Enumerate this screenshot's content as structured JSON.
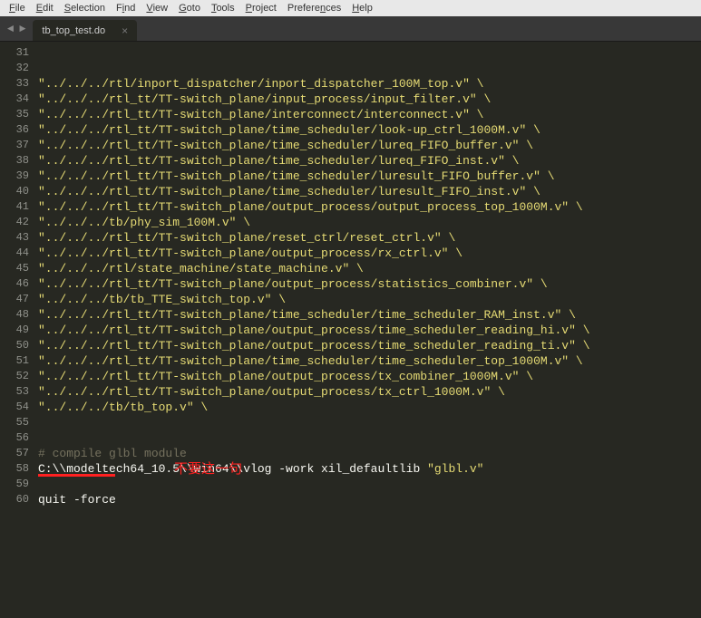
{
  "menubar": {
    "items": [
      {
        "ul": "F",
        "rest": "ile"
      },
      {
        "ul": "E",
        "rest": "dit"
      },
      {
        "ul": "S",
        "rest": "election"
      },
      {
        "ul": "",
        "rest": "F",
        "ul2": "i",
        "rest2": "nd"
      },
      {
        "ul": "V",
        "rest": "iew"
      },
      {
        "ul": "G",
        "rest": "oto"
      },
      {
        "ul": "T",
        "rest": "ools"
      },
      {
        "ul": "P",
        "rest": "roject"
      },
      {
        "ul": "",
        "rest": "Prefere",
        "ul2": "n",
        "rest2": "ces"
      },
      {
        "ul": "H",
        "rest": "elp"
      }
    ]
  },
  "tab": {
    "title": "tb_top_test.do",
    "close": "×"
  },
  "nav": {
    "back": "◄",
    "fwd": "►"
  },
  "lines": [
    {
      "n": "31",
      "cls": "str",
      "t": "\"../../../rtl/inport_dispatcher/inport_dispatcher_100M_top.v\" \\"
    },
    {
      "n": "32",
      "cls": "str",
      "t": "\"../../../rtl_tt/TT-switch_plane/input_process/input_filter.v\" \\"
    },
    {
      "n": "33",
      "cls": "str",
      "t": "\"../../../rtl_tt/TT-switch_plane/interconnect/interconnect.v\" \\"
    },
    {
      "n": "34",
      "cls": "str",
      "t": "\"../../../rtl_tt/TT-switch_plane/time_scheduler/look-up_ctrl_1000M.v\" \\"
    },
    {
      "n": "35",
      "cls": "str",
      "t": "\"../../../rtl_tt/TT-switch_plane/time_scheduler/lureq_FIFO_buffer.v\" \\"
    },
    {
      "n": "36",
      "cls": "str",
      "t": "\"../../../rtl_tt/TT-switch_plane/time_scheduler/lureq_FIFO_inst.v\" \\"
    },
    {
      "n": "37",
      "cls": "str",
      "t": "\"../../../rtl_tt/TT-switch_plane/time_scheduler/luresult_FIFO_buffer.v\" \\"
    },
    {
      "n": "38",
      "cls": "str",
      "t": "\"../../../rtl_tt/TT-switch_plane/time_scheduler/luresult_FIFO_inst.v\" \\"
    },
    {
      "n": "39",
      "cls": "str",
      "t": "\"../../../rtl_tt/TT-switch_plane/output_process/output_process_top_1000M.v\" \\"
    },
    {
      "n": "40",
      "cls": "str",
      "t": "\"../../../tb/phy_sim_100M.v\" \\"
    },
    {
      "n": "41",
      "cls": "str",
      "t": "\"../../../rtl_tt/TT-switch_plane/reset_ctrl/reset_ctrl.v\" \\"
    },
    {
      "n": "42",
      "cls": "str",
      "t": "\"../../../rtl_tt/TT-switch_plane/output_process/rx_ctrl.v\" \\"
    },
    {
      "n": "43",
      "cls": "str",
      "t": "\"../../../rtl/state_machine/state_machine.v\" \\"
    },
    {
      "n": "44",
      "cls": "str",
      "t": "\"../../../rtl_tt/TT-switch_plane/output_process/statistics_combiner.v\" \\"
    },
    {
      "n": "45",
      "cls": "str",
      "t": "\"../../../tb/tb_TTE_switch_top.v\" \\"
    },
    {
      "n": "46",
      "cls": "str",
      "t": "\"../../../rtl_tt/TT-switch_plane/time_scheduler/time_scheduler_RAM_inst.v\" \\"
    },
    {
      "n": "47",
      "cls": "str",
      "t": "\"../../../rtl_tt/TT-switch_plane/output_process/time_scheduler_reading_hi.v\" \\"
    },
    {
      "n": "48",
      "cls": "str",
      "t": "\"../../../rtl_tt/TT-switch_plane/output_process/time_scheduler_reading_ti.v\" \\"
    },
    {
      "n": "49",
      "cls": "str",
      "t": "\"../../../rtl_tt/TT-switch_plane/time_scheduler/time_scheduler_top_1000M.v\" \\"
    },
    {
      "n": "50",
      "cls": "str",
      "t": "\"../../../rtl_tt/TT-switch_plane/output_process/tx_combiner_1000M.v\" \\"
    },
    {
      "n": "51",
      "cls": "str",
      "t": "\"../../../rtl_tt/TT-switch_plane/output_process/tx_ctrl_1000M.v\" \\"
    },
    {
      "n": "52",
      "cls": "str",
      "t": "\"../../../tb/tb_top.v\" \\"
    },
    {
      "n": "53",
      "cls": "plain",
      "t": ""
    },
    {
      "n": "54",
      "cls": "plain",
      "t": ""
    },
    {
      "n": "55",
      "cls": "cmt",
      "t": "# compile glbl module"
    },
    {
      "n": "56",
      "cls": "plain",
      "t": "C:\\\\modeltech64_10.5\\\\win64\\\\vlog -work xil_defaultlib \"glbl.v\""
    },
    {
      "n": "57",
      "cls": "plain",
      "t": ""
    },
    {
      "n": "58",
      "cls": "plain",
      "t": "quit -force"
    },
    {
      "n": "59",
      "cls": "plain",
      "t": ""
    },
    {
      "n": "60",
      "cls": "plain",
      "t": ""
    }
  ],
  "annotation": {
    "text": "不要这一句"
  }
}
